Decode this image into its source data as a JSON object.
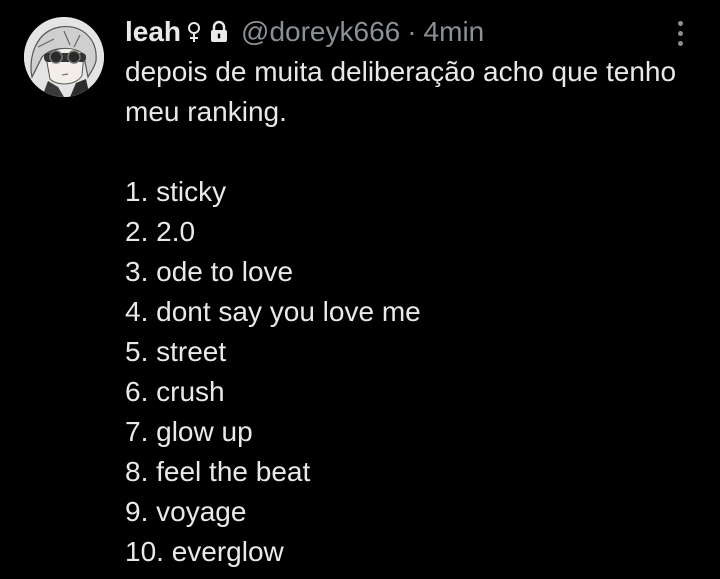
{
  "tweet": {
    "author": {
      "display_name": "leah",
      "handle": "@doreyk666",
      "avatar_icon": "anime-avatar-icon",
      "gender_icon": "female-symbol-icon",
      "protected_icon": "lock-icon"
    },
    "separator": "·",
    "time": "4min",
    "more_icon": "more-vertical-icon",
    "intro": "depois de muita deliberação acho que tenho meu ranking.",
    "ranking": [
      "1. sticky",
      "2. 2.0",
      "3. ode to love",
      "4. dont say you love me",
      "5. street",
      "6. crush",
      "7. glow up",
      "8. feel the beat",
      "9. voyage",
      "10. everglow"
    ]
  },
  "colors": {
    "background": "#000000",
    "text": "#e7e9ea",
    "secondary_text": "#8b9094"
  }
}
